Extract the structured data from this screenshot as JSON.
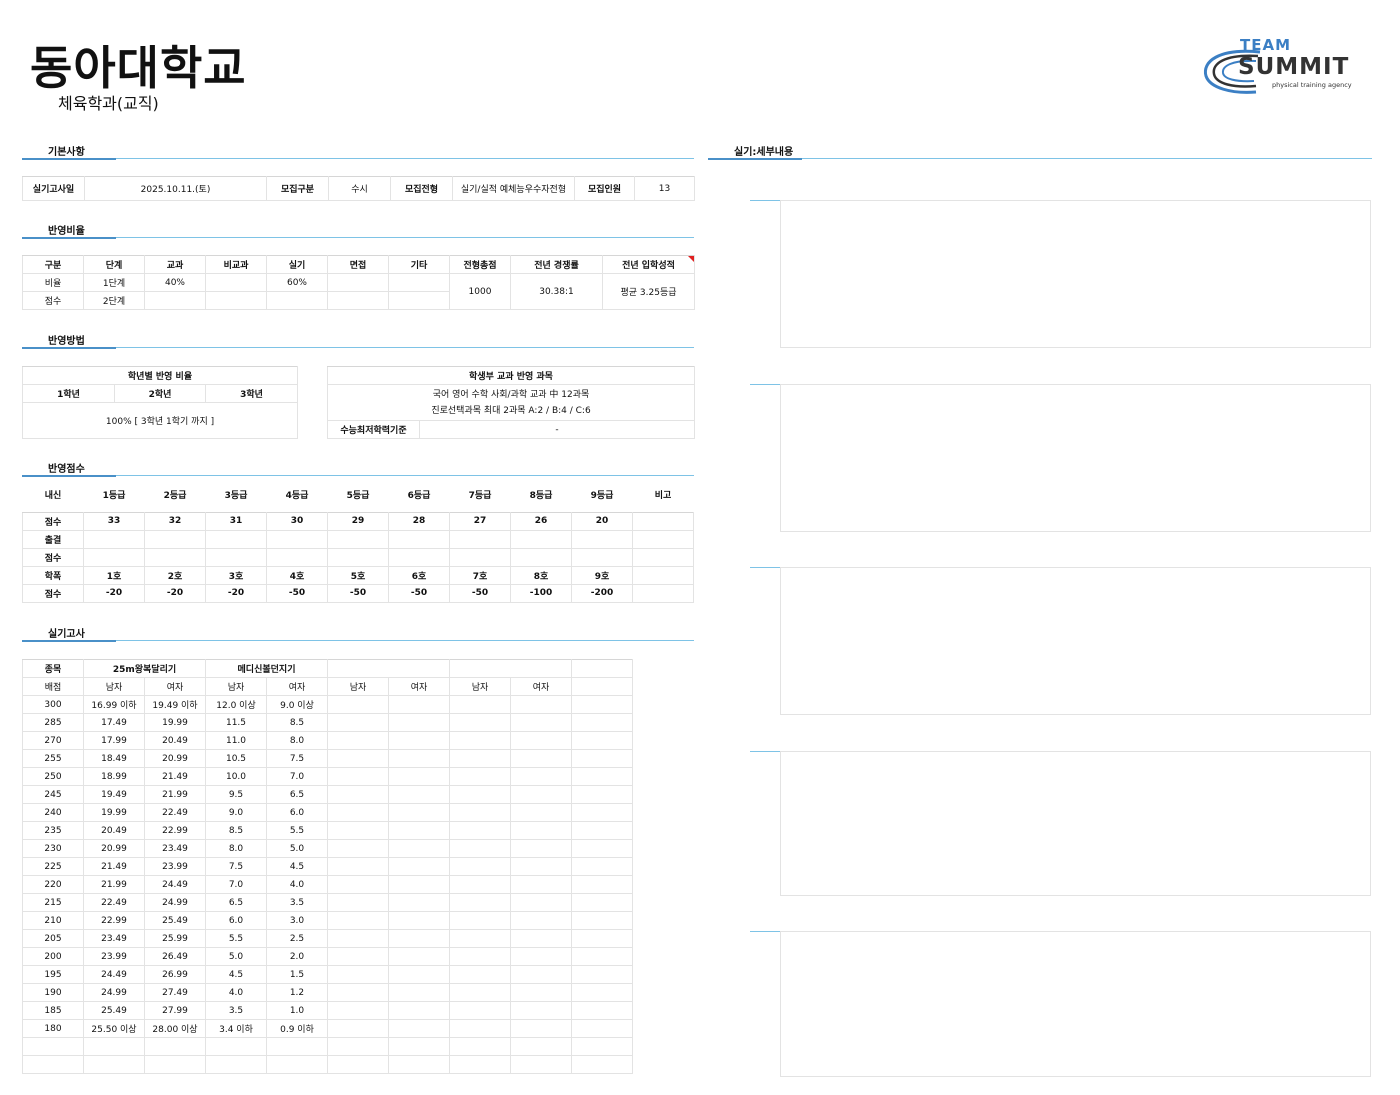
{
  "header": {
    "school": "동아대학교",
    "department": "체육학과(교직)",
    "logo": {
      "top": "TEAM",
      "main": "SUMMIT",
      "tagline": "physical training agency"
    }
  },
  "colors": {
    "accent": "#4a90c8",
    "rule": "#7ec3e6",
    "logo_blue": "#3b7fc4",
    "logo_dark": "#333333",
    "note_red": "#e02020"
  },
  "sections": {
    "basic": "기본사항",
    "ratio": "반영비율",
    "method": "반영방법",
    "score": "반영점수",
    "exam": "실기고사",
    "detail": "실기:세부내용"
  },
  "basic_info": {
    "exam_date_label": "실기고사일",
    "exam_date": "2025.10.11.(토)",
    "type_label": "모집구분",
    "type": "수시",
    "track_label": "모집전형",
    "track": "실기/실적 예체능우수자전형",
    "quota_label": "모집인원",
    "quota": "13"
  },
  "ratio_table": {
    "headers": [
      "구분",
      "단계",
      "교과",
      "비교과",
      "실기",
      "면접",
      "기타",
      "전형총점",
      "전년 경쟁률",
      "전년 입학성적"
    ],
    "rows": [
      [
        "비율",
        "1단계",
        "40%",
        "",
        "60%",
        "",
        ""
      ],
      [
        "점수",
        "2단계",
        "",
        "",
        "",
        "",
        ""
      ]
    ],
    "total": "1000",
    "competition": "30.38:1",
    "prev_score": "평균 3.25등급"
  },
  "method": {
    "grade_title": "학년별 반영 비율",
    "grades": [
      "1학년",
      "2학년",
      "3학년"
    ],
    "grade_value": "100% [ 3학년 1학기 까지 ]",
    "subject_title": "학생부 교과 반영 과목",
    "subject_line1": "국어 영어 수학 사회/과학 교과 中 12과목",
    "subject_line2": "진로선택과목 최대 2과목 A:2 / B:4 / C:6",
    "min_label": "수능최저학력기준",
    "min_value": "-"
  },
  "score_table": {
    "header": [
      "내신",
      "1등급",
      "2등급",
      "3등급",
      "4등급",
      "5등급",
      "6등급",
      "7등급",
      "8등급",
      "9등급",
      "비고"
    ],
    "grade_label": "점수",
    "grade_scores": [
      "33",
      "32",
      "31",
      "30",
      "29",
      "28",
      "27",
      "26",
      "20",
      ""
    ],
    "attendance_label": "출결",
    "attendance_score_label": "점수",
    "discipline_label": "학폭",
    "discipline_levels": [
      "1호",
      "2호",
      "3호",
      "4호",
      "5호",
      "6호",
      "7호",
      "8호",
      "9호",
      ""
    ],
    "discipline_score_label": "점수",
    "discipline_scores": [
      "-20",
      "-20",
      "-20",
      "-50",
      "-50",
      "-50",
      "-50",
      "-100",
      "-200",
      ""
    ]
  },
  "exam_table": {
    "event_label": "종목",
    "events": [
      "25m왕복달리기",
      "메디신볼던지기",
      "",
      ""
    ],
    "points_label": "배점",
    "genders": [
      "남자",
      "여자",
      "남자",
      "여자",
      "남자",
      "여자",
      "남자",
      "여자"
    ],
    "rows": [
      [
        "300",
        "16.99 이하",
        "19.49 이하",
        "12.0 이상",
        "9.0 이상"
      ],
      [
        "285",
        "17.49",
        "19.99",
        "11.5",
        "8.5"
      ],
      [
        "270",
        "17.99",
        "20.49",
        "11.0",
        "8.0"
      ],
      [
        "255",
        "18.49",
        "20.99",
        "10.5",
        "7.5"
      ],
      [
        "250",
        "18.99",
        "21.49",
        "10.0",
        "7.0"
      ],
      [
        "245",
        "19.49",
        "21.99",
        "9.5",
        "6.5"
      ],
      [
        "240",
        "19.99",
        "22.49",
        "9.0",
        "6.0"
      ],
      [
        "235",
        "20.49",
        "22.99",
        "8.5",
        "5.5"
      ],
      [
        "230",
        "20.99",
        "23.49",
        "8.0",
        "5.0"
      ],
      [
        "225",
        "21.49",
        "23.99",
        "7.5",
        "4.5"
      ],
      [
        "220",
        "21.99",
        "24.49",
        "7.0",
        "4.0"
      ],
      [
        "215",
        "22.49",
        "24.99",
        "6.5",
        "3.5"
      ],
      [
        "210",
        "22.99",
        "25.49",
        "6.0",
        "3.0"
      ],
      [
        "205",
        "23.49",
        "25.99",
        "5.5",
        "2.5"
      ],
      [
        "200",
        "23.99",
        "26.49",
        "5.0",
        "2.0"
      ],
      [
        "195",
        "24.49",
        "26.99",
        "4.5",
        "1.5"
      ],
      [
        "190",
        "24.99",
        "27.49",
        "4.0",
        "1.2"
      ],
      [
        "185",
        "25.49",
        "27.99",
        "3.5",
        "1.0"
      ],
      [
        "180",
        "25.50 이상",
        "28.00 이상",
        "3.4 이하",
        "0.9 이하"
      ]
    ]
  }
}
